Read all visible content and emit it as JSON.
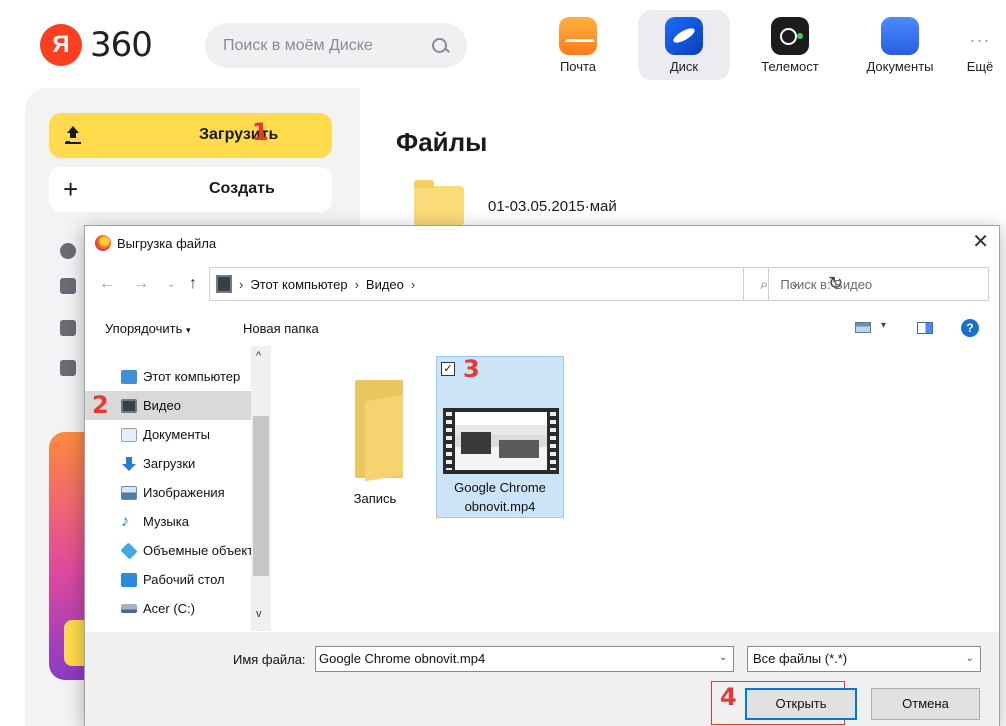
{
  "header": {
    "logo_text": "360",
    "search_placeholder": "Поиск в моём Диске",
    "apps": [
      {
        "label": "Почта",
        "icon": "mail-icon"
      },
      {
        "label": "Диск",
        "icon": "disk-icon",
        "active": true
      },
      {
        "label": "Телемост",
        "icon": "telemost-icon"
      },
      {
        "label": "Документы",
        "icon": "documents-icon"
      },
      {
        "label": "Ещё",
        "icon": "more-icon"
      }
    ]
  },
  "sidebar": {
    "upload_label": "Загрузить",
    "create_label": "Создать"
  },
  "main": {
    "title": "Файлы",
    "folder_name": "01-03.05.2015·май"
  },
  "markers": {
    "m1": "1",
    "m2": "2",
    "m3": "3",
    "m4": "4"
  },
  "dialog": {
    "title": "Выгрузка файла",
    "address": [
      "Этот компьютер",
      "Видео"
    ],
    "search_placeholder": "Поиск в: Видео",
    "toolbar": {
      "organize": "Упорядочить",
      "new_folder": "Новая папка"
    },
    "nav_items": [
      {
        "label": "Этот компьютер",
        "icon": "computer-icon"
      },
      {
        "label": "Видео",
        "icon": "video-folder-icon",
        "selected": true
      },
      {
        "label": "Документы",
        "icon": "documents-folder-icon"
      },
      {
        "label": "Загрузки",
        "icon": "downloads-icon"
      },
      {
        "label": "Изображения",
        "icon": "pictures-icon"
      },
      {
        "label": "Музыка",
        "icon": "music-icon"
      },
      {
        "label": "Объемные объекты",
        "icon": "3d-objects-icon"
      },
      {
        "label": "Рабочий стол",
        "icon": "desktop-icon"
      },
      {
        "label": "Acer (C:)",
        "icon": "drive-icon"
      }
    ],
    "files": [
      {
        "name": "Запись",
        "type": "folder"
      },
      {
        "name_line1": "Google Chrome",
        "name_line2": "obnovit.mp4",
        "type": "video",
        "selected": true,
        "checked": true
      }
    ],
    "filename_label": "Имя файла:",
    "filename_value": "Google Chrome obnovit.mp4",
    "filetype_value": "Все файлы (*.*)",
    "open_label": "Открыть",
    "cancel_label": "Отмена"
  },
  "colors": {
    "accent_yellow": "#ffdb4d",
    "marker_red": "#e53935",
    "selection_blue": "#cce4f7",
    "open_button_border": "#0078d7"
  }
}
